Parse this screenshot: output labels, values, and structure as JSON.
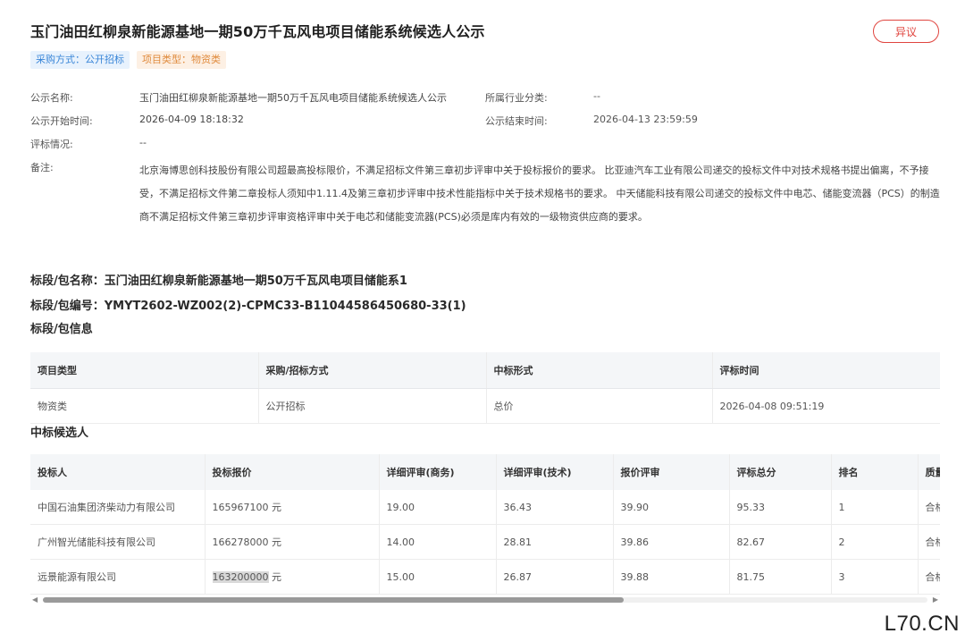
{
  "header": {
    "title": "玉门油田红柳泉新能源基地一期50万千瓦风电项目储能系统候选人公示",
    "objection_label": "异议",
    "tags": [
      "采购方式：公开招标",
      "项目类型：物资类"
    ]
  },
  "info": {
    "name_label": "公示名称:",
    "name_value": "玉门油田红柳泉新能源基地一期50万千瓦风电项目储能系统候选人公示",
    "industry_label": "所属行业分类:",
    "industry_value": "--",
    "start_label": "公示开始时间:",
    "start_value": "2026-04-09 18:18:32",
    "end_label": "公示结束时间:",
    "end_value": "2026-04-13 23:59:59",
    "eval_label": "评标情况:",
    "eval_value": "--",
    "remark_label": "备注:",
    "remark_value": "北京海博思创科技股份有限公司超最高投标限价，不满足招标文件第三章初步评审中关于投标报价的要求。 比亚迪汽车工业有限公司递交的投标文件中对技术规格书提出偏离，不予接受，不满足招标文件第二章投标人须知中1.11.4及第三章初步评审中技术性能指标中关于技术规格书的要求。 中天储能科技有限公司递交的投标文件中电芯、储能变流器（PCS）的制造商不满足招标文件第三章初步评审资格评审中关于电芯和储能变流器(PCS)必须是库内有效的一级物资供应商的要求。"
  },
  "section": {
    "package_name": "标段/包名称：玉门油田红柳泉新能源基地一期50万千瓦风电项目储能系1",
    "package_no": "标段/包编号：YMYT2602-WZ002(2)-CPMC33-B11044586450680-33(1)",
    "package_info": "标段/包信息",
    "candidates_title": "中标候选人"
  },
  "package_table": {
    "headers": [
      "项目类型",
      "采购/招标方式",
      "中标形式",
      "评标时间"
    ],
    "row": [
      "物资类",
      "公开招标",
      "总价",
      "2026-04-08 09:51:19"
    ]
  },
  "candidates_table": {
    "headers": [
      "投标人",
      "投标报价",
      "详细评审(商务)",
      "详细评审(技术)",
      "报价评审",
      "评标总分",
      "排名",
      "质量"
    ],
    "rows": [
      {
        "bidder": "中国石油集团济柴动力有限公司",
        "price": "165967100",
        "unit": " 元",
        "business": "19.00",
        "tech": "36.43",
        "quote": "39.90",
        "total": "95.33",
        "rank": "1",
        "quality": "合格"
      },
      {
        "bidder": "广州智光储能科技有限公司",
        "price": "166278000",
        "unit": " 元",
        "business": "14.00",
        "tech": "28.81",
        "quote": "39.86",
        "total": "82.67",
        "rank": "2",
        "quality": "合格"
      },
      {
        "bidder": "远景能源有限公司",
        "price": "163200000",
        "unit": " 元",
        "business": "15.00",
        "tech": "26.87",
        "quote": "39.88",
        "total": "81.75",
        "rank": "3",
        "quality": "合格"
      }
    ]
  },
  "watermark": "L70.CN"
}
